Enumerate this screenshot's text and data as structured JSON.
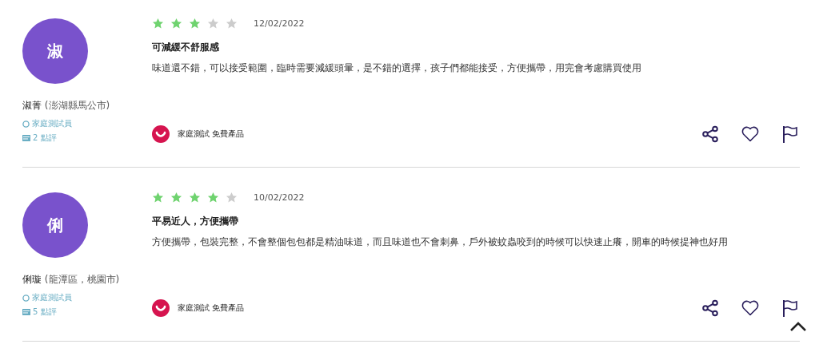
{
  "reviews": [
    {
      "avatar": "淑",
      "name": "淑菁",
      "location": "(澎湖縣馬公市)",
      "role": "家庭測試員",
      "review_count": "2 點評",
      "stars": 3,
      "date": "12/02/2022",
      "title": "可減緩不舒服感",
      "body": "味道還不錯，可以接受範圍，臨時需要減緩頭暈，是不錯的選擇，孩子們都能接受，方便攜帶，用完會考慮購買使用",
      "badge": "家庭測試 免費產品"
    },
    {
      "avatar": "俐",
      "name": "俐璇",
      "location": "(龍潭區，桃園市)",
      "role": "家庭測試員",
      "review_count": "5 點評",
      "stars": 4,
      "date": "10/02/2022",
      "title": "平易近人，方便攜帶",
      "body": "方便攜帶，包裝完整，不會整個包包都是精油味道，而且味道也不會刺鼻，戶外被蚊蟲咬到的時候可以快速止癢，開車的時候提神也好用",
      "badge": "家庭測試 免費產品"
    }
  ]
}
